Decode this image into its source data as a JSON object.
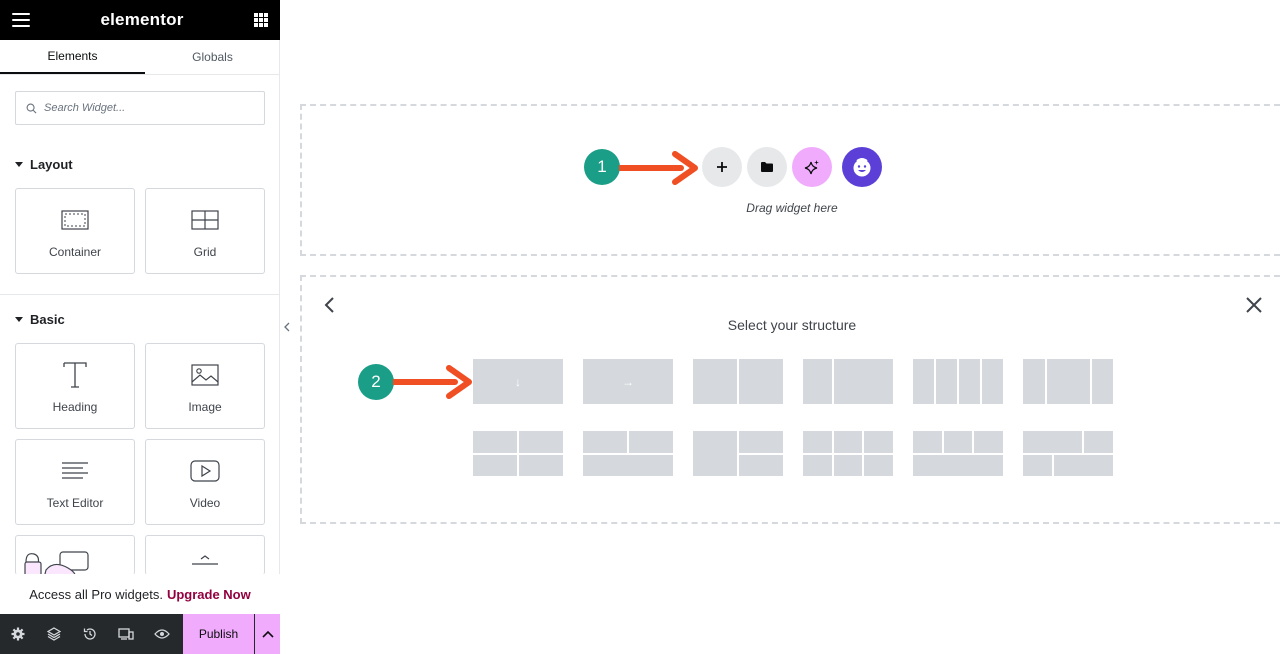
{
  "topbar": {
    "logo": "elementor"
  },
  "tabs": [
    {
      "label": "Elements"
    },
    {
      "label": "Globals"
    }
  ],
  "search": {
    "placeholder": "Search Widget..."
  },
  "categories": {
    "layout": {
      "label": "Layout",
      "widgets": [
        {
          "label": "Container",
          "icon": "container-icon"
        },
        {
          "label": "Grid",
          "icon": "grid-icon"
        }
      ]
    },
    "basic": {
      "label": "Basic",
      "widgets": [
        {
          "label": "Heading",
          "icon": "heading-icon"
        },
        {
          "label": "Image",
          "icon": "image-icon"
        },
        {
          "label": "Text Editor",
          "icon": "text-editor-icon"
        },
        {
          "label": "Video",
          "icon": "video-icon"
        }
      ]
    }
  },
  "promo": {
    "text": "Access all Pro widgets.",
    "link": "Upgrade Now"
  },
  "footer": {
    "publish_label": "Publish",
    "icons": [
      "settings-icon",
      "layers-icon",
      "history-icon",
      "responsive-icon",
      "preview-icon"
    ]
  },
  "canvas": {
    "drag_text": "Drag widget here",
    "buttons": [
      "add-section",
      "template-library",
      "ai-assistant",
      "emoji-ai"
    ],
    "structure_title": "Select your structure",
    "step_badges": [
      "1",
      "2"
    ]
  },
  "colors": {
    "accent_pink": "#f0abfc",
    "step_green": "#1a9e87",
    "arrow_red": "#f04e23",
    "brand_purple": "#5b3fd6",
    "upgrade": "#93003f"
  }
}
